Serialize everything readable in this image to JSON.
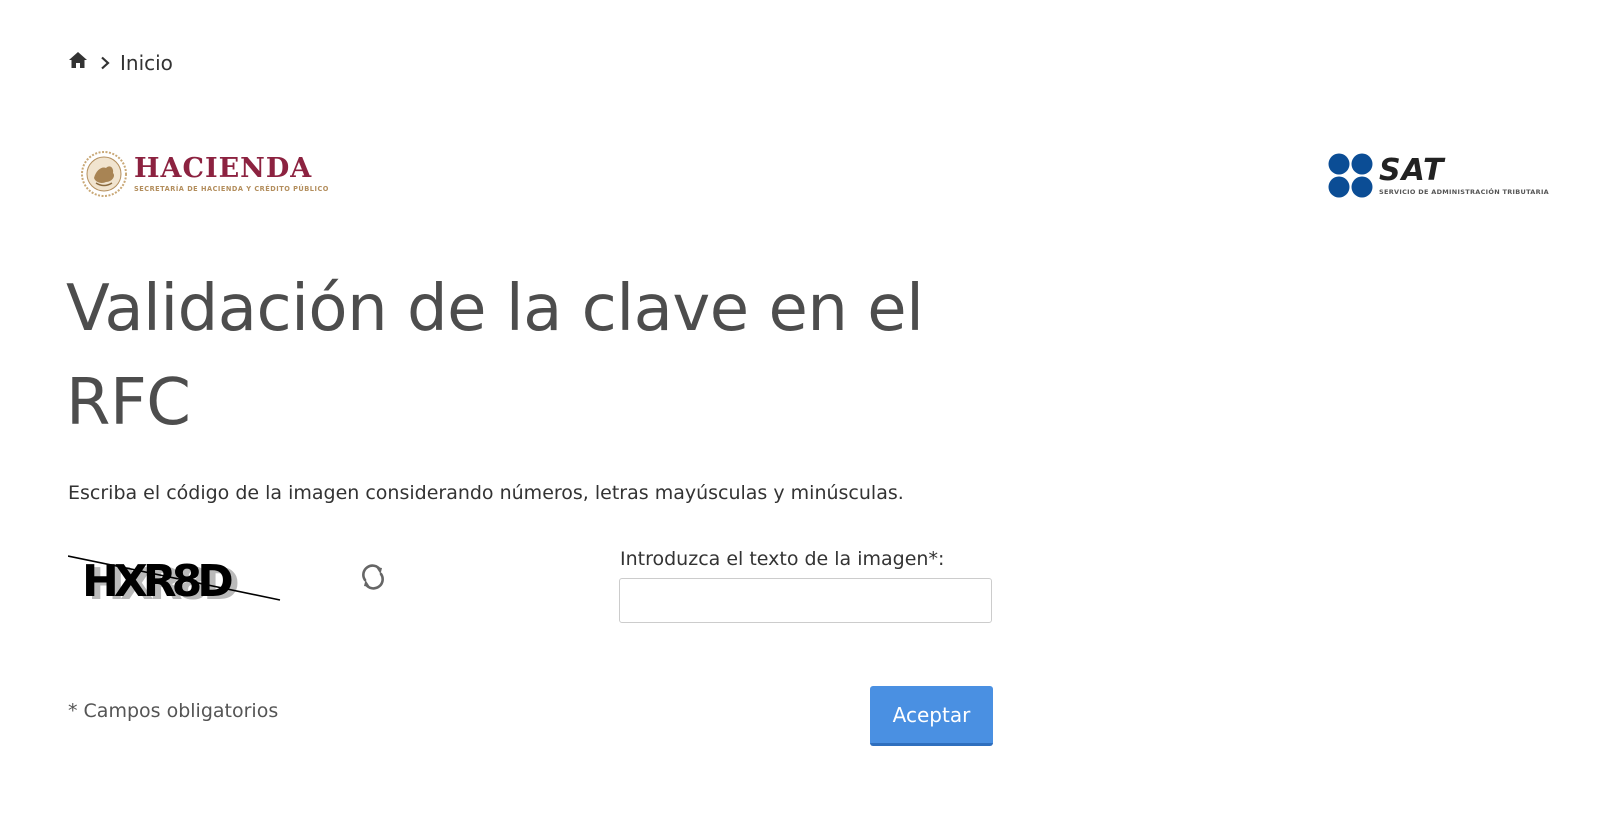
{
  "breadcrumb": {
    "home_icon": "home-icon",
    "separator_icon": "chevron-right-icon",
    "items": [
      {
        "label": "Inicio"
      }
    ]
  },
  "logos": {
    "hacienda": {
      "title": "HACIENDA",
      "subtitle": "SECRETARÍA DE HACIENDA Y CRÉDITO PÚBLICO",
      "title_color": "#8c2240",
      "subtitle_color": "#b38e5d"
    },
    "sat": {
      "title": "SAT",
      "subtitle": "SERVICIO DE ADMINISTRACIÓN TRIBUTARIA",
      "dot_color": "#0b4d95"
    }
  },
  "page": {
    "title": "Validación de la clave en el RFC",
    "instructions": "Escriba el código de la imagen considerando números, letras mayúsculas y minúsculas."
  },
  "captcha": {
    "code": "HXR8D",
    "refresh_icon": "refresh-icon",
    "input_label": "Introduzca el texto de la imagen*:",
    "input_value": "",
    "input_placeholder": ""
  },
  "form": {
    "required_note": "* Campos obligatorios",
    "submit_label": "Aceptar",
    "submit_color": "#4a90e2"
  }
}
